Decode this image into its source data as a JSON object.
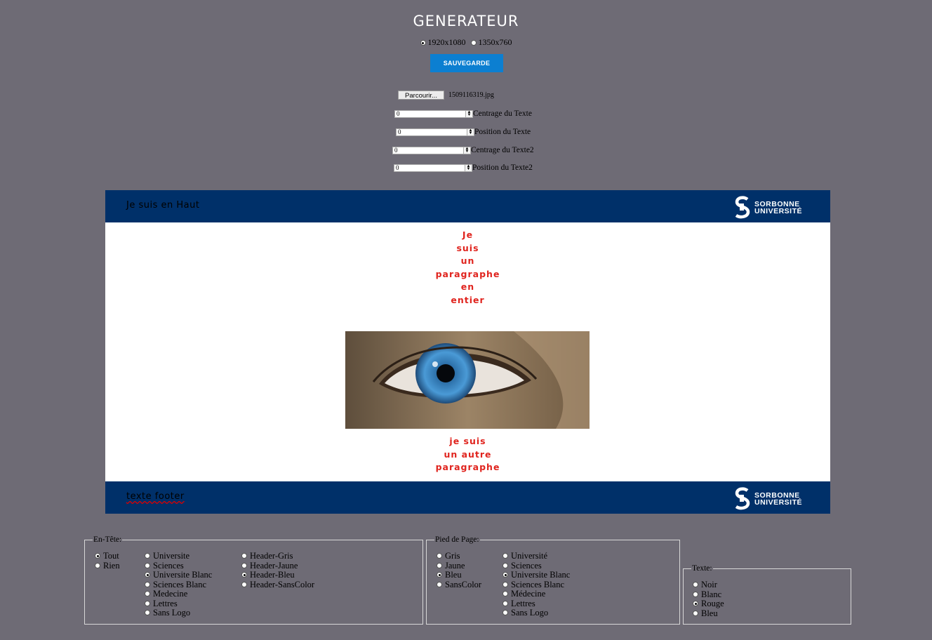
{
  "header": {
    "title": "GENERATEUR"
  },
  "resolution": {
    "options": [
      {
        "label": "1920x1080",
        "checked": true
      },
      {
        "label": "1350x760",
        "checked": false
      }
    ]
  },
  "save_button": "SAUVEGARDE",
  "file": {
    "button_label": "Parcourir...",
    "file_name": "1509116319.jpg"
  },
  "numeric_fields": [
    {
      "value": "0",
      "label": "Centrage du Texte"
    },
    {
      "value": "0",
      "label": "Position du Texte"
    },
    {
      "value": "0",
      "label": "Centrage du Texte2"
    },
    {
      "value": "0",
      "label": "Position du Texte2"
    }
  ],
  "preview": {
    "header_text": "Je suis en Haut",
    "logo_line1": "SORBONNE",
    "logo_line2": "UNIVERSITÉ",
    "paragraph1": [
      "Je",
      "suis",
      "un",
      "paragraphe",
      "en",
      "entier"
    ],
    "paragraph2": [
      "je suis",
      "un autre",
      "paragraphe"
    ],
    "footer_text": "texte footer",
    "colors": {
      "bar": "#003069",
      "text": "#e0241e"
    }
  },
  "entete": {
    "legend": "En-Tête:",
    "col1": [
      {
        "label": "Tout",
        "checked": true
      },
      {
        "label": "Rien",
        "checked": false
      }
    ],
    "col2": [
      {
        "label": "Universite",
        "checked": false
      },
      {
        "label": "Sciences",
        "checked": false
      },
      {
        "label": "Universite Blanc",
        "checked": true
      },
      {
        "label": "Sciences Blanc",
        "checked": false
      },
      {
        "label": "Medecine",
        "checked": false
      },
      {
        "label": "Lettres",
        "checked": false
      },
      {
        "label": "Sans Logo",
        "checked": false
      }
    ],
    "col3": [
      {
        "label": "Header-Gris",
        "checked": false
      },
      {
        "label": "Header-Jaune",
        "checked": false
      },
      {
        "label": "Header-Bleu",
        "checked": true
      },
      {
        "label": "Header-SansColor",
        "checked": false
      }
    ]
  },
  "pied": {
    "legend": "Pied de Page:",
    "col1": [
      {
        "label": "Gris",
        "checked": false
      },
      {
        "label": "Jaune",
        "checked": false
      },
      {
        "label": "Bleu",
        "checked": true
      },
      {
        "label": "SansColor",
        "checked": false
      }
    ],
    "col2": [
      {
        "label": "Université",
        "checked": false
      },
      {
        "label": "Sciences",
        "checked": false
      },
      {
        "label": "Universite Blanc",
        "checked": true
      },
      {
        "label": "Sciences Blanc",
        "checked": false
      },
      {
        "label": "Médecine",
        "checked": false
      },
      {
        "label": "Lettres",
        "checked": false
      },
      {
        "label": "Sans Logo",
        "checked": false
      }
    ]
  },
  "texte": {
    "legend": "Texte:",
    "options": [
      {
        "label": "Noir",
        "checked": false
      },
      {
        "label": "Blanc",
        "checked": false
      },
      {
        "label": "Rouge",
        "checked": true
      },
      {
        "label": "Bleu",
        "checked": false
      }
    ]
  }
}
